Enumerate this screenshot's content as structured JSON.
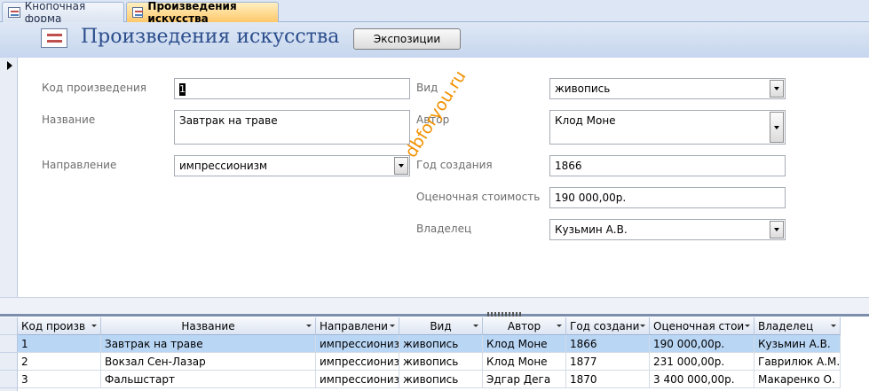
{
  "tabs": [
    {
      "label": "Кнопочная форма"
    },
    {
      "label": "Произведения искусства"
    }
  ],
  "header": {
    "title": "Произведения искусства",
    "button_label": "Экспозиции"
  },
  "form": {
    "code_label": "Код произведения",
    "code_value": "1",
    "name_label": "Название",
    "name_value": "Завтрак на траве",
    "direction_label": "Направление",
    "direction_value": "импрессионизм",
    "kind_label": "Вид",
    "kind_value": "живопись",
    "author_label": "Автор",
    "author_value": "Клод Моне",
    "year_label": "Год создания",
    "year_value": "1866",
    "cost_label": "Оценочная стоимость",
    "cost_value": "190 000,00р.",
    "owner_label": "Владелец",
    "owner_value": "Кузьмин А.В."
  },
  "watermark": "dbforyou.ru",
  "datasheet": {
    "columns": [
      "Код произв",
      "Название",
      "Направлени",
      "Вид",
      "Автор",
      "Год создани",
      "Оценочная стои",
      "Владелец"
    ],
    "rows": [
      [
        "1",
        "Завтрак на траве",
        "импрессионизм",
        "живопись",
        "Клод Моне",
        "1866",
        "190 000,00р.",
        "Кузьмин А.В."
      ],
      [
        "2",
        "Вокзал Сен-Лазар",
        "импрессионизм",
        "живопись",
        "Клод Моне",
        "1877",
        "231 000,00р.",
        "Гаврилюк А.М."
      ],
      [
        "3",
        "Фальшстарт",
        "импрессионизм",
        "живопись",
        "Эдгар Дега",
        "1870",
        "3 400 000,00р.",
        "Макаренко О."
      ]
    ],
    "selected_row": 0
  }
}
